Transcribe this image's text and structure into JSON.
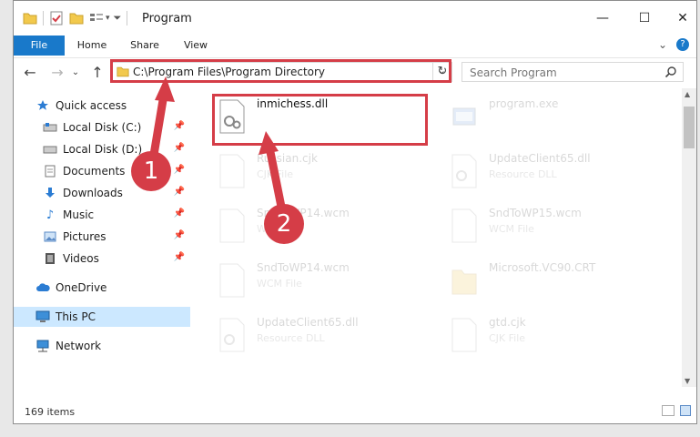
{
  "window": {
    "title": "Program",
    "controls": {
      "minimize": "—",
      "maximize": "☐",
      "close": "✕"
    }
  },
  "ribbon": {
    "tabs": [
      {
        "label": "File"
      },
      {
        "label": "Home"
      },
      {
        "label": "Share"
      },
      {
        "label": "View"
      }
    ]
  },
  "address": {
    "path": "C:\\Program Files\\Program Directory"
  },
  "search": {
    "placeholder": "Search Program"
  },
  "nav": {
    "items": [
      {
        "label": "Quick access",
        "icon": "star-icon"
      },
      {
        "label": "Local Disk (C:)",
        "icon": "drive-icon"
      },
      {
        "label": "Local Disk (D:)",
        "icon": "drive-icon"
      },
      {
        "label": "Documents",
        "icon": "documents-icon"
      },
      {
        "label": "Downloads",
        "icon": "download-icon"
      },
      {
        "label": "Music",
        "icon": "music-icon"
      },
      {
        "label": "Pictures",
        "icon": "pictures-icon"
      },
      {
        "label": "Videos",
        "icon": "videos-icon"
      },
      {
        "label": "OneDrive",
        "icon": "cloud-icon"
      },
      {
        "label": "This PC",
        "icon": "computer-icon"
      },
      {
        "label": "Network",
        "icon": "network-icon"
      }
    ]
  },
  "files": [
    {
      "name": "inmichess.dll",
      "desc": ""
    },
    {
      "name": "program.exe",
      "desc": ""
    },
    {
      "name": "Russian.cjk",
      "desc": "CJK File"
    },
    {
      "name": "UpdateClient65.dll",
      "desc": "Resource DLL"
    },
    {
      "name": "SndToWP14.wcm",
      "desc": "WCM File"
    },
    {
      "name": "SndToWP15.wcm",
      "desc": "WCM File"
    },
    {
      "name": "SndToWP14.wcm",
      "desc": "WCM File"
    },
    {
      "name": "Microsoft.VC90.CRT",
      "desc": ""
    },
    {
      "name": "UpdateClient65.dll",
      "desc": "Resource DLL"
    },
    {
      "name": "gtd.cjk",
      "desc": "CJK File"
    }
  ],
  "status": {
    "item_count": "169 items"
  },
  "annotations": {
    "marker1": "1",
    "marker2": "2",
    "color": "#d53d47"
  }
}
